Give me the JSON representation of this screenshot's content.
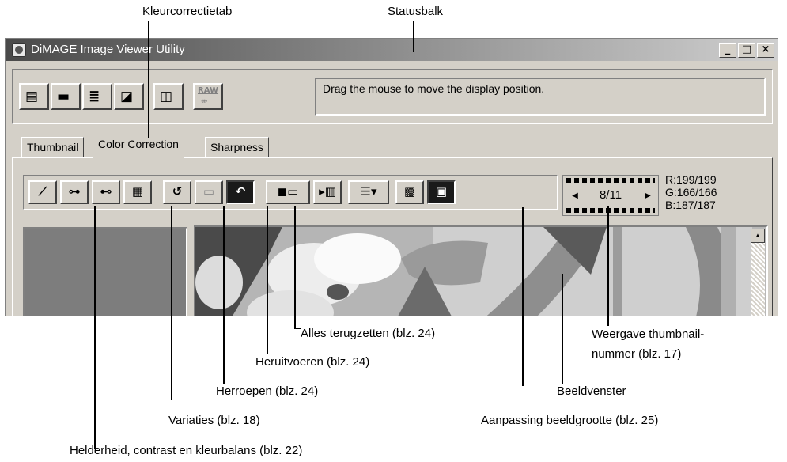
{
  "callouts": {
    "color_tab": "Kleurcorrectietab",
    "statusbar": "Statusbalk",
    "reset_all": "Alles terugzetten (blz. 24)",
    "redo": "Heruitvoeren (blz. 24)",
    "undo": "Herroepen (blz. 24)",
    "variations": "Variaties (blz. 18)",
    "brightness": "Helderheid, contrast en kleurbalans (blz. 22)",
    "thumb_number_1": "Weergave thumbnail-",
    "thumb_number_2": "nummer (blz. 17)",
    "image_window": "Beeldvenster",
    "image_size": "Aanpassing beeldgrootte (blz. 25)"
  },
  "window": {
    "title": "DiMAGE Image Viewer Utility",
    "minimize": "_",
    "maximize": "□",
    "close": "×"
  },
  "toolbar": {
    "raw_label": "RAW",
    "status_text": "Drag the mouse to move the display position."
  },
  "tabs": [
    {
      "label": "Thumbnail"
    },
    {
      "label": "Color Correction"
    },
    {
      "label": "Sharpness"
    }
  ],
  "counter": {
    "text": "8/11",
    "prev": "◀",
    "next": "▶"
  },
  "rgb": {
    "r": "R:199/199",
    "g": "G:166/166",
    "b": "B:187/187"
  },
  "colors": {
    "window_bg": "#d4d0c8",
    "title_dark": "#4a4a4a",
    "title_light": "#cfcfcf"
  }
}
